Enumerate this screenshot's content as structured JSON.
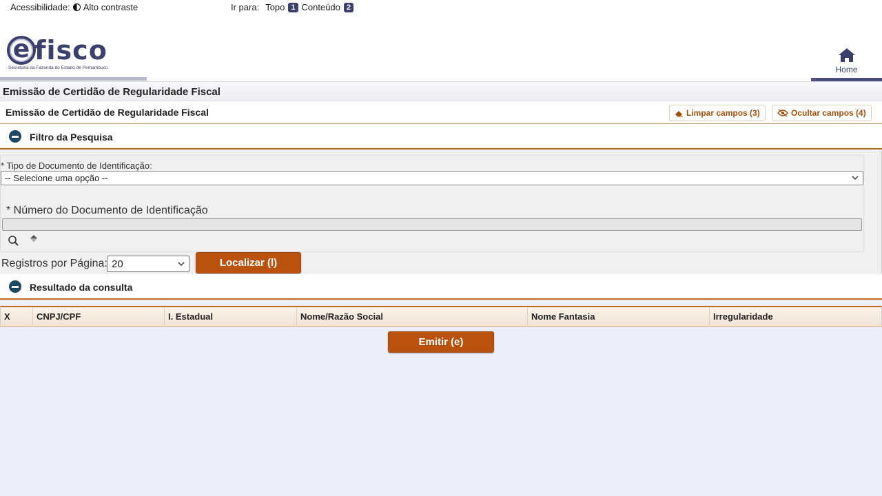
{
  "topbar": {
    "accessibility_label": "Acessibilidade:",
    "contrast_label": "Alto contraste",
    "jump_label": "Ir para:",
    "top_label": "Topo",
    "top_key": "1",
    "content_label": "Conteúdo",
    "content_key": "2"
  },
  "header": {
    "logo_text": "fisco",
    "logo_letter": "e",
    "logo_subtitle": "Secretaria da Fazenda do Estado de Pernambuco",
    "home_label": "Home"
  },
  "page": {
    "title": "Emissão de Certidão de Regularidade Fiscal",
    "form_title": "Emissão de Certidão de Regularidade Fiscal",
    "clear_button": "Limpar campos (3)",
    "hide_button": "Ocultar campos (4)"
  },
  "filter": {
    "section_label": "Filtro da Pesquisa",
    "doc_type_label": "* Tipo de Documento de Identificação:",
    "doc_type_value": "-- Selecione uma opção --",
    "doc_number_label": "* Número do Documento de Identificação",
    "doc_number_value": "",
    "per_page_label": "Registros por Página:",
    "per_page_value": "20",
    "search_button": "Localizar (l)"
  },
  "result": {
    "section_label": "Resultado da consulta",
    "columns": [
      "X",
      "CNPJ/CPF",
      "I. Estadual",
      "Nome/Razão Social",
      "Nome Fantasia",
      "Irregularidade"
    ],
    "emit_button": "Emitir (e)"
  },
  "colors": {
    "brand": "#3b3f6b",
    "accent": "#b8520e",
    "section_icon": "#1e4766",
    "background": "#eeeef8"
  }
}
